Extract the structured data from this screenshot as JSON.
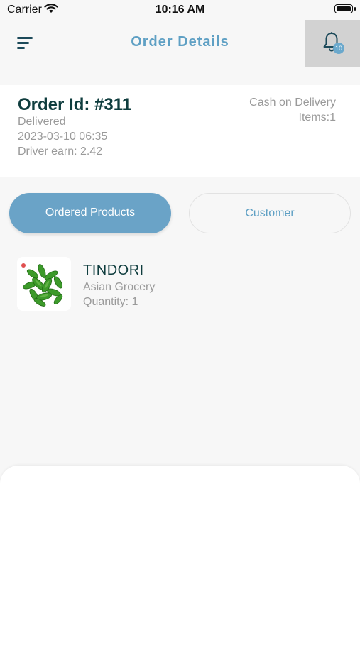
{
  "status_bar": {
    "carrier": "Carrier",
    "time": "10:16 AM"
  },
  "header": {
    "title": "Order Details",
    "notification_count": "10"
  },
  "order": {
    "id": "Order Id: #311",
    "status": "Delivered",
    "datetime": "2023-03-10 06:35",
    "driver_earn": "Driver earn: 2.42",
    "payment_method": "Cash on Delivery",
    "items": "Items:1"
  },
  "tabs": [
    {
      "label": "Ordered Products",
      "active": true
    },
    {
      "label": "Customer",
      "active": false
    }
  ],
  "products": [
    {
      "name": "TINDORI",
      "category": "Asian Grocery",
      "quantity": "Quantity: 1"
    }
  ],
  "colors": {
    "accent": "#6aa3c7",
    "title": "#5fa0c4",
    "heading": "#0f3d3e",
    "muted": "#9a9a9a"
  }
}
